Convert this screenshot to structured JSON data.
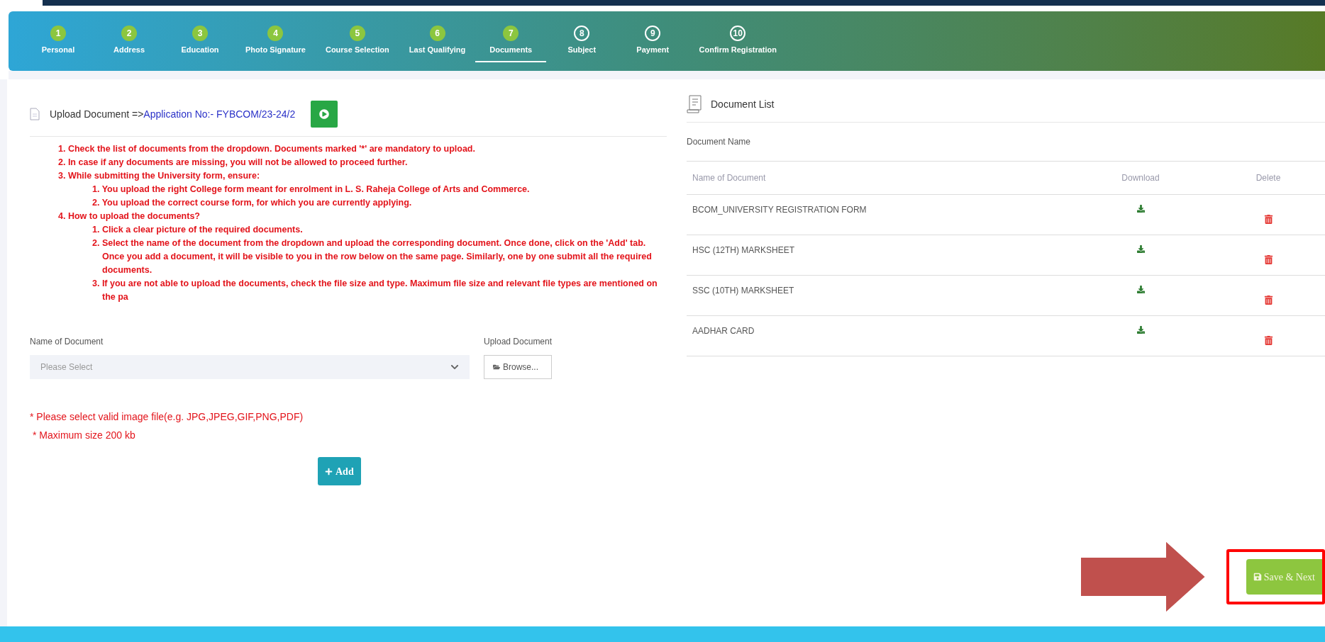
{
  "steps": [
    {
      "number": "1",
      "label": "Personal",
      "done": true,
      "selected": false
    },
    {
      "number": "2",
      "label": "Address",
      "done": true,
      "selected": false
    },
    {
      "number": "3",
      "label": "Education",
      "done": true,
      "selected": false
    },
    {
      "number": "4",
      "label": "Photo Signature",
      "done": true,
      "selected": false
    },
    {
      "number": "5",
      "label": "Course Selection",
      "done": true,
      "selected": false
    },
    {
      "number": "6",
      "label": "Last Qualifying",
      "done": true,
      "selected": false
    },
    {
      "number": "7",
      "label": "Documents",
      "done": true,
      "selected": true
    },
    {
      "number": "8",
      "label": "Subject",
      "done": false,
      "selected": false
    },
    {
      "number": "9",
      "label": "Payment",
      "done": false,
      "selected": false
    },
    {
      "number": "10",
      "label": "Confirm Registration",
      "done": false,
      "selected": false
    }
  ],
  "upload": {
    "title": "Upload Document =>",
    "application": "Application No:- FYBCOM/23-24/2",
    "instructions": [
      {
        "text": "1. Check the list of documents from the dropdown. Documents marked '*' are mandatory to upload."
      },
      {
        "text": "2. In case if any documents are missing, you will not be allowed to proceed further."
      },
      {
        "text": "3. While submitting the University form, ensure:",
        "children": [
          {
            "text": "1. You upload the right College form meant for enrolment in L. S. Raheja College of Arts and Commerce."
          },
          {
            "text": "2. You upload the correct course form, for which you are currently applying."
          }
        ]
      },
      {
        "text": "4. How to upload the documents?",
        "children": [
          {
            "text": "1. Click a clear picture of the required documents."
          },
          {
            "text": "2. Select the name of the document from the dropdown and upload the corresponding document. Once done, click on the 'Add' tab. Once you add a document, it will be visible to you in the row below on the same page. Similarly, one by one submit all the required documents."
          },
          {
            "text": "3. If you are not able to upload the documents, check the file size and type. Maximum file size and relevant file types are mentioned on the pa"
          }
        ]
      }
    ],
    "name_label": "Name of Document",
    "select": {
      "placeholder": "Please Select"
    },
    "upload_label": "Upload Document",
    "browse": "Browse...",
    "notes": [
      "* Please select valid image file(e.g. JPG,JPEG,GIF,PNG,PDF)",
      "* Maximum size 200 kb"
    ],
    "add": "Add"
  },
  "document_list": {
    "title": "Document List",
    "subtitle": "Document Name",
    "columns": [
      "Name of Document",
      "Download",
      "Delete"
    ],
    "rows": [
      {
        "name": "BCOM_UNIVERSITY REGISTRATION FORM"
      },
      {
        "name": "HSC (12TH) MARKSHEET"
      },
      {
        "name": "SSC (10TH) MARKSHEET"
      },
      {
        "name": "AADHAR CARD"
      }
    ]
  },
  "save_next": "Save & Next"
}
